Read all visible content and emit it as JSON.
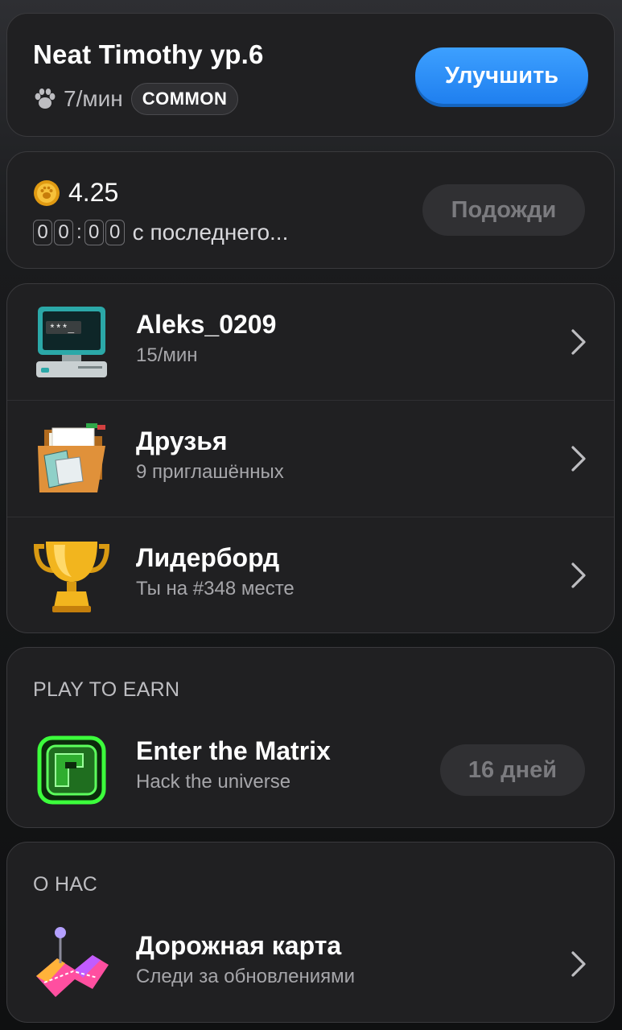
{
  "pet": {
    "name_level": "Neat Timothy ур.6",
    "rate": "7/мин",
    "rarity": "COMMON",
    "upgrade_label": "Улучшить"
  },
  "earnings": {
    "balance": "4.25",
    "timer_digits": [
      "0",
      "0",
      "0",
      "0"
    ],
    "timer_suffix": "с последнего...",
    "wait_label": "Подожди"
  },
  "menu": [
    {
      "title": "Aleks_0209",
      "subtitle": "15/мин",
      "icon": "computer-terminal-icon"
    },
    {
      "title": "Друзья",
      "subtitle": "9 приглашённых",
      "icon": "folder-icon"
    },
    {
      "title": "Лидерборд",
      "subtitle": "Ты на #348 месте",
      "icon": "trophy-icon"
    }
  ],
  "play_to_earn": {
    "section_label": "PLAY TO EARN",
    "title": "Enter the Matrix",
    "subtitle": "Hack the universe",
    "badge": "16 дней",
    "icon": "matrix-chip-icon"
  },
  "about": {
    "section_label": "О НАС",
    "title": "Дорожная карта",
    "subtitle": "Следи за обновлениями",
    "icon": "roadmap-icon"
  },
  "colors": {
    "accent_blue": "#2a8cf7",
    "card_bg": "#202022",
    "muted_text": "#a6a6aa"
  }
}
